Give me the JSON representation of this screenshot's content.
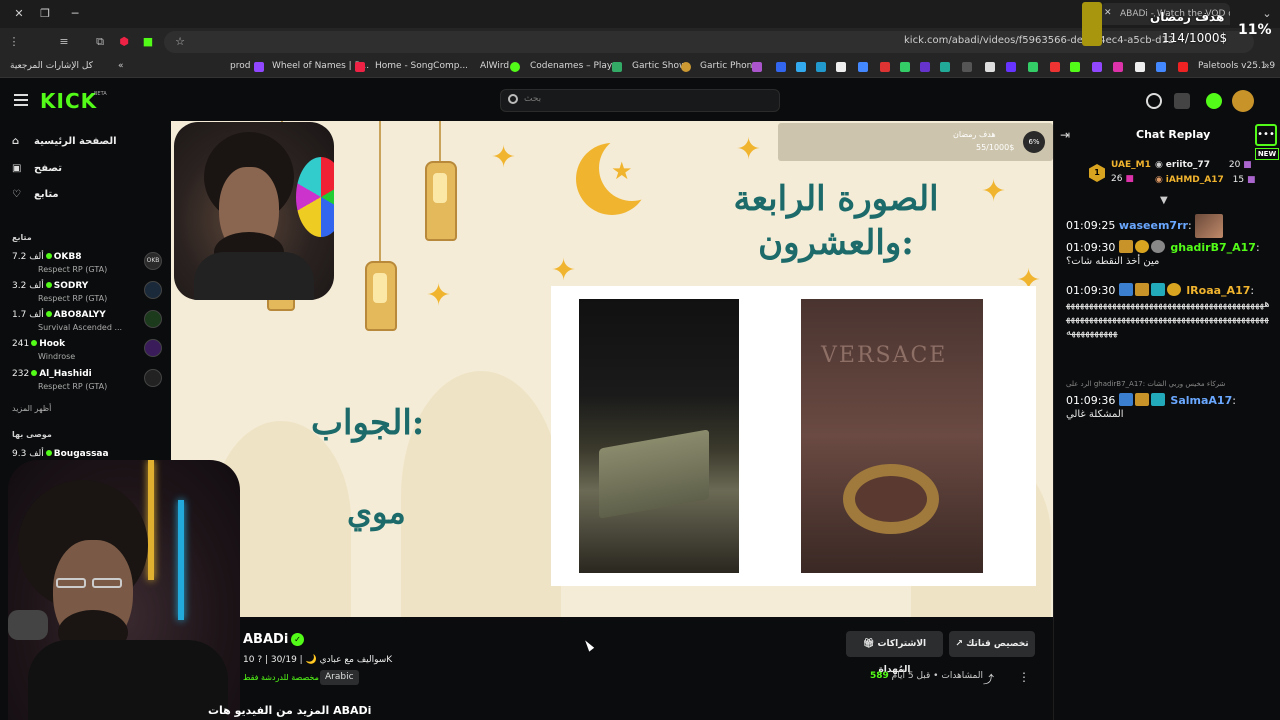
{
  "browser": {
    "tab_title": "ABADi - Watch the VOD on",
    "url": "kick.com/abadi/videos/f5963566-de2b-4ec4-a5cb-d12e125bf6",
    "bookmarks": [
      "كل الإشارات المرجعية",
      "prod",
      "Wheel of Names | R...",
      "Home - SongComp...",
      "AlWird",
      "Codenames – Play...",
      "Gartic Show",
      "Gartic Phone",
      "Paletools v25.1.9"
    ],
    "overlay_goal_title": "هدف رمضان",
    "overlay_goal_value": "114/1000$",
    "overlay_percent": "11%"
  },
  "header": {
    "logo": "KICK",
    "beta": "BETA",
    "search_placeholder": "بحث"
  },
  "sidebar": {
    "nav": [
      {
        "label": "الصفحة الرئيسية",
        "icon": "home-icon"
      },
      {
        "label": "تصفح",
        "icon": "browse-icon"
      },
      {
        "label": "متابع",
        "icon": "heart-icon"
      }
    ],
    "following_title": "متابع",
    "channels": [
      {
        "viewers": "7.2 ألف",
        "name": "OKB8",
        "game": "Respect RP (GTA)",
        "avatar": "OKB"
      },
      {
        "viewers": "3.2 ألف",
        "name": "SODRY",
        "game": "Respect RP (GTA)",
        "avatar": ""
      },
      {
        "viewers": "1.7 ألف",
        "name": "ABO8ALYY",
        "game": "Survival Ascended ...",
        "avatar": ""
      },
      {
        "viewers": "241",
        "name": "Hook",
        "game": "Windrose",
        "avatar": ""
      },
      {
        "viewers": "232",
        "name": "Al_Hashidi",
        "game": "Respect RP (GTA)",
        "avatar": ""
      }
    ],
    "show_more": "أظهر المزيد",
    "recommended_title": "موصى بها",
    "recommended": [
      {
        "viewers": "9.3 ألف",
        "name": "Bougassaa"
      }
    ]
  },
  "video": {
    "title_line1": "الصورة الرابعة",
    "title_line2": "والعشرون:",
    "answer_label": "الجواب:",
    "answer": "موي",
    "brand_in_photo": "VERSACE",
    "goal_title": "هدف رمضان",
    "goal_value": "55/1000$",
    "goal_percent": "6%"
  },
  "info": {
    "streamer": "ABADi",
    "subtitle": "سواليف مع عبادي 🌙 | 30/19 | ? 10K",
    "chat_mode": "مخصصة للدردشة فقط",
    "language": "Arabic",
    "subscribe_button": "الاشتراكات المُهداة",
    "customize_button": "تخصيص قناتك",
    "views_label": "المشاهدات",
    "views_value": "589",
    "time_ago": "قبل 5 أيام",
    "more_videos": "المزيد من الفيديو هات ABADi"
  },
  "chat": {
    "title": "Chat Replay",
    "new_label": "NEW",
    "leaders": [
      {
        "name": "UAE_M1",
        "count": "26"
      },
      {
        "name": "eriito_77",
        "count": "20"
      },
      {
        "name": "iAHMD_A17",
        "count": "15"
      }
    ],
    "messages": [
      {
        "time": "01:09:25",
        "user": "waseem7rr",
        "text": "",
        "color": "#6aa8ff"
      },
      {
        "time": "01:09:30",
        "user": "ghadirB7_A17",
        "text": "مين أخذ النقطه شات؟",
        "color": "#53fc18"
      },
      {
        "time": "01:09:30",
        "user": "lRoaa_A17",
        "text": "ههههههههههههههههههههههههههههههههههههههههههههههههههههههههههههههههههههههههههههههههههههههههههههههههههه",
        "color": "#f1b42e"
      },
      {
        "time": "01:09:36",
        "user": "SalmaA17",
        "text": "المشكلة غالي",
        "color": "#6aa8ff"
      }
    ],
    "reply_context": "الرد على ghadirB7_A17: شركاء مخيس وربي الشات"
  }
}
